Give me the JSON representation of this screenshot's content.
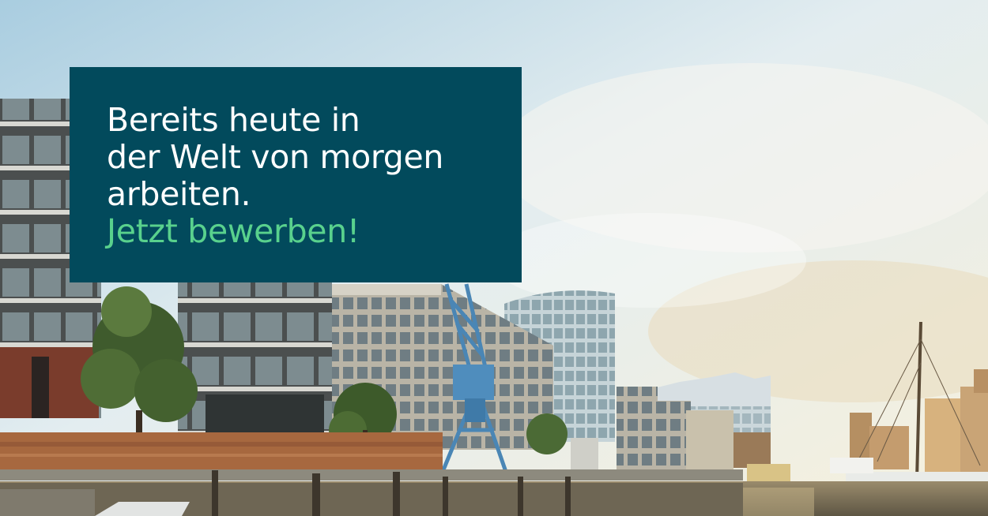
{
  "banner": {
    "headline_lines": [
      "Bereits heute in",
      "der Welt von morgen",
      "arbeiten."
    ],
    "cta": "Jetzt bewerben!"
  },
  "colors": {
    "box_background": "#024a5c",
    "headline_text": "#ffffff",
    "cta_text": "#59d18d"
  }
}
